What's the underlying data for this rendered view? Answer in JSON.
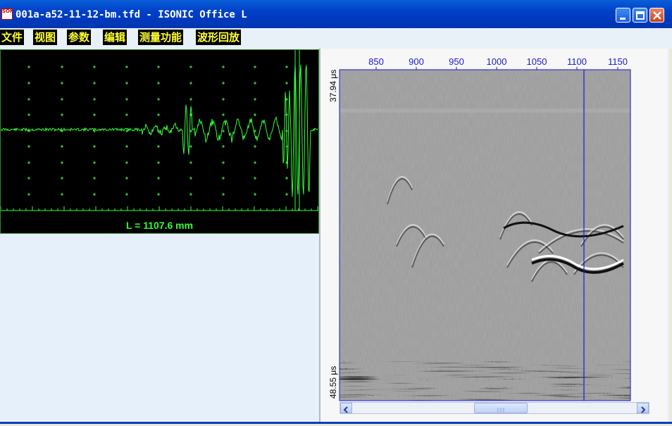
{
  "window": {
    "title": "001a-a52-11-12-bm.tfd - ISONIC Office L",
    "app_icon_text": "SONIC",
    "accent_color": "#0040c8"
  },
  "menu": {
    "items": [
      {
        "label": "文件"
      },
      {
        "label": "视图"
      },
      {
        "label": "参数"
      },
      {
        "label": "编辑"
      },
      {
        "label": "测量功能"
      },
      {
        "label": "波形回放"
      }
    ],
    "text_color": "#ffff33",
    "bg_color": "#000000"
  },
  "ascan": {
    "readout": "L = 1107.6 mm",
    "trace_color": "#33ff33"
  },
  "bscan": {
    "x_ticks": [
      "850",
      "900",
      "950",
      "1000",
      "1050",
      "1100",
      "1150"
    ],
    "y_top_label": "37.94 μs",
    "y_bottom_label": "48.55 μs",
    "cursor_position": "1107.6",
    "axis_color": "#1a1acc"
  },
  "scrollbar": {
    "thumb_label": "III",
    "left_icon": "chevron-left-icon",
    "right_icon": "chevron-right-icon"
  }
}
